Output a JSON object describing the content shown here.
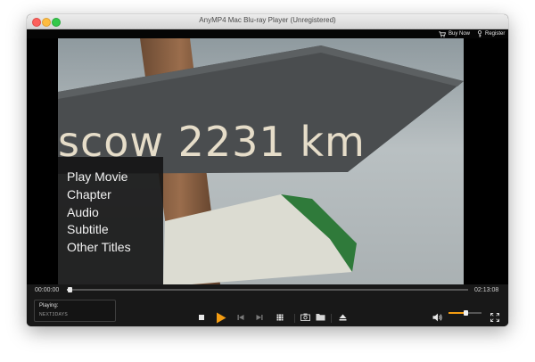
{
  "window": {
    "title": "AnyMP4 Mac Blu-ray Player (Unregistered)"
  },
  "topbar": {
    "buy_now": "Buy Now",
    "register": "Register",
    "buy_icon": "cart-icon",
    "register_icon": "key-icon"
  },
  "video": {
    "sign_text": "scow 2231 km"
  },
  "dvd_menu": {
    "items": [
      "Play Movie",
      "Chapter",
      "Audio",
      "Subtitle",
      "Other Titles"
    ]
  },
  "playback": {
    "current_time": "00:00:00",
    "total_time": "02:13:08",
    "progress": 0.005,
    "playing_label": "Playing:",
    "playing_title": "NEXT3DAYS",
    "volume": 0.5
  },
  "controls": {
    "icons": [
      "stop-icon",
      "play-icon",
      "previous-icon",
      "next-icon",
      "menu-grid-icon",
      "snapshot-icon",
      "open-folder-icon",
      "eject-icon",
      "volume-icon",
      "fullscreen-icon"
    ]
  },
  "colors": {
    "accent": "#f39c12",
    "menu_bg": "#141414",
    "titlebar": "#e0e0e0"
  }
}
